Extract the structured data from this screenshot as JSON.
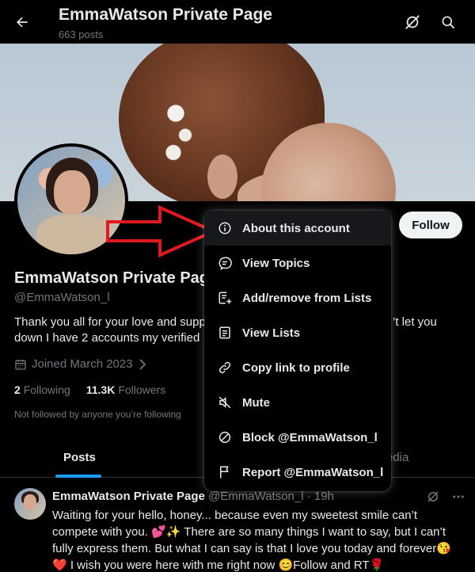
{
  "header": {
    "title": "EmmaWatson Private Page",
    "post_count": "663 posts",
    "back_icon": "arrow-left-icon",
    "notifications_off_icon": "bell-off-icon",
    "search_icon": "search-icon"
  },
  "profile": {
    "display_name": "EmmaWatson Private Pag",
    "handle": "@EmmaWatson_l",
    "bio_line1": "Thank you all for your love and supp",
    "bio_line2": "down  I have 2 accounts my verified",
    "bio_right": "’t let you",
    "joined": "Joined March 2023",
    "following_count": "2",
    "following_label": "Following",
    "followers_count": "11.3K",
    "followers_label": "Followers",
    "not_followed": "Not followed by anyone you’re following",
    "follow_button": "Follow"
  },
  "tabs": {
    "posts": "Posts",
    "media_partial": "edia"
  },
  "menu": {
    "items": [
      {
        "label": "About this account",
        "icon": "info-icon"
      },
      {
        "label": "View Topics",
        "icon": "topics-icon"
      },
      {
        "label": "Add/remove from Lists",
        "icon": "list-add-icon"
      },
      {
        "label": "View Lists",
        "icon": "lists-icon"
      },
      {
        "label": "Copy link to profile",
        "icon": "link-icon"
      },
      {
        "label": "Mute",
        "icon": "mute-icon"
      },
      {
        "label": "Block @EmmaWatson_l",
        "icon": "block-icon"
      },
      {
        "label": "Report @EmmaWatson_l",
        "icon": "flag-icon"
      }
    ]
  },
  "tweet": {
    "name": "EmmaWatson Private Page",
    "handle_time": " @EmmaWatson_l · 19h",
    "line1": "Waiting for your hello, honey... because even my sweetest smile can’t",
    "line2": "compete with you. 💕✨ There are so many things I want to say, but I can’t",
    "line3": "fully express them. But what I can say is that I love you today and forever😘",
    "line4": "❤️ I wish you were here with me right now 😊Follow and RT🌹"
  },
  "colors": {
    "background": "#000000",
    "accent": "#1d9bf0",
    "annotation_arrow": "#e0191f"
  }
}
